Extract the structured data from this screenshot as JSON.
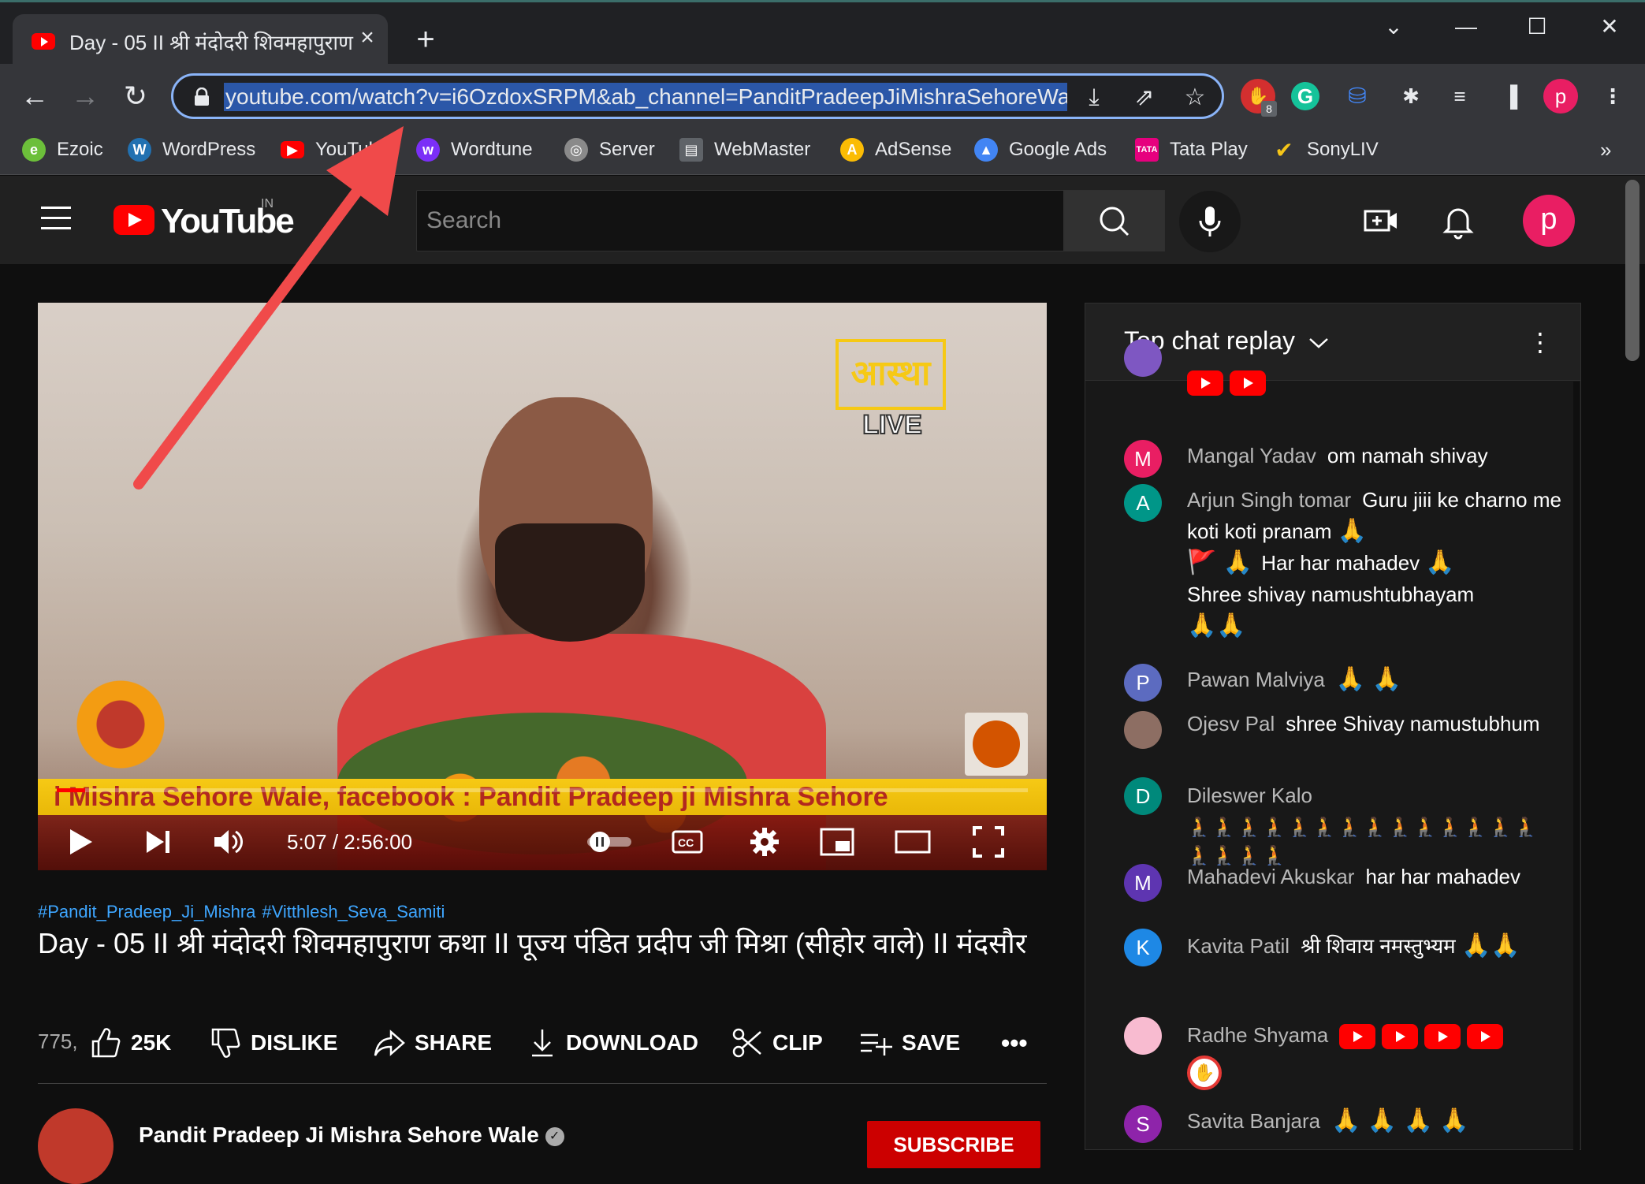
{
  "browser": {
    "tab_title": "Day - 05 II श्री मंदोदरी शिवमहापुराण",
    "new_tab_icon": "plus-icon",
    "url": "youtube.com/watch?v=i6OzdoxSRPM&ab_channel=PanditPradeepJiMishraSehoreWale",
    "profile_initial": "p",
    "extension_badge": "8",
    "bookmarks": [
      {
        "label": "Ezoic",
        "icon": "ezoic-icon",
        "color": "#6cbf3a"
      },
      {
        "label": "WordPress",
        "icon": "wordpress-icon",
        "color": "#2271b1"
      },
      {
        "label": "YouTube",
        "icon": "youtube-icon",
        "color": "#ff0000"
      },
      {
        "label": "Wordtune",
        "icon": "wordtune-icon",
        "color": "#7b2ff7"
      },
      {
        "label": "Server",
        "icon": "globe-icon",
        "color": "#8a8a8a"
      },
      {
        "label": "WebMaster",
        "icon": "webmaster-icon",
        "color": "#5f6368"
      },
      {
        "label": "AdSense",
        "icon": "adsense-icon",
        "color": "#fbbc04"
      },
      {
        "label": "Google Ads",
        "icon": "google-ads-icon",
        "color": "#4285f4"
      },
      {
        "label": "Tata Play",
        "icon": "tata-play-icon",
        "color": "#e6007e"
      },
      {
        "label": "SonyLIV",
        "icon": "sonyliv-icon",
        "color": "#f5c518"
      }
    ],
    "bookmarks_overflow": "»"
  },
  "youtube": {
    "logo_text": "YouTube",
    "country": "IN",
    "search_placeholder": "Search",
    "avatar_initial": "p"
  },
  "player": {
    "channel_logo_text": "आस्था",
    "live_label": "LIVE",
    "ticker": "i Mishra Sehore Wale, facebook : Pandit Pradeep ji Mishra Sehore",
    "time_current": "5:07",
    "time_total": "2:56:00",
    "progress": 0.029
  },
  "video": {
    "hashtags": [
      "#Pandit_Pradeep_Ji_Mishra",
      "#Vitthlesh_Seva_Samiti"
    ],
    "title": "Day - 05 II श्री मंदोदरी शिवमहापुराण कथा II पूज्य पंडित प्रदीप जी मिश्रा (सीहोर वाले) II मंदसौर",
    "views": "775,",
    "actions": {
      "like": "25K",
      "dislike": "DISLIKE",
      "share": "SHARE",
      "download": "DOWNLOAD",
      "clip": "CLIP",
      "save": "SAVE"
    },
    "channel_name": "Pandit Pradeep Ji Mishra Sehore Wale",
    "subscribe": "SUBSCRIBE"
  },
  "chat": {
    "mode": "Top chat replay",
    "messages": [
      {
        "initial": "M",
        "color": "#e91e63",
        "author": "Mangal Yadav",
        "text": "om namah shivay",
        "emoji": ""
      },
      {
        "initial": "A",
        "color": "#009688",
        "author": "Arjun Singh tomar",
        "text": "Guru jiii ke charno me koti koti pranam",
        "emoji": "🙏"
      },
      {
        "initial": "",
        "color": "",
        "author": "",
        "text": "Har har mahadev",
        "emoji": "🚩 🙏"
      },
      {
        "initial": "",
        "color": "",
        "author": "",
        "text": "Shree shivay namushtubhayam",
        "emoji": "🙏🙏"
      },
      {
        "initial": "P",
        "color": "#5c6bc0",
        "author": "Pawan Malviya",
        "text": "",
        "emoji": "🙏 🙏"
      },
      {
        "initial": "",
        "color": "#8d6e63",
        "author": "Ojesv Pal",
        "text": "shree Shivay namustubhum",
        "emoji": ""
      },
      {
        "initial": "D",
        "color": "#00897b",
        "author": "Dileswer Kalo",
        "text": "",
        "emoji": "🧎🧎🧎🧎🧎🧎🧎🧎🧎🧎🧎🧎🧎🧎🧎🧎🧎🧎"
      },
      {
        "initial": "M",
        "color": "#5e35b1",
        "author": "Mahadevi Akuskar",
        "text": "har har mahadev",
        "emoji": ""
      },
      {
        "initial": "K",
        "color": "#1e88e5",
        "author": "Kavita Patil",
        "text": "श्री शिवाय नमस्तुभ्यम",
        "emoji": "🙏🙏"
      },
      {
        "initial": "",
        "color": "#f8bbd0",
        "author": "Radhe Shyama",
        "text": "",
        "emoji": ""
      },
      {
        "initial": "S",
        "color": "#8e24aa",
        "author": "Savita Banjara",
        "text": "",
        "emoji": "🙏 🙏 🙏 🙏"
      }
    ]
  },
  "colors": {
    "accent_blue": "#8ab4f8",
    "youtube_red": "#ff0000",
    "link_blue": "#3ea6ff",
    "annotation_arrow": "#f04a4a"
  }
}
